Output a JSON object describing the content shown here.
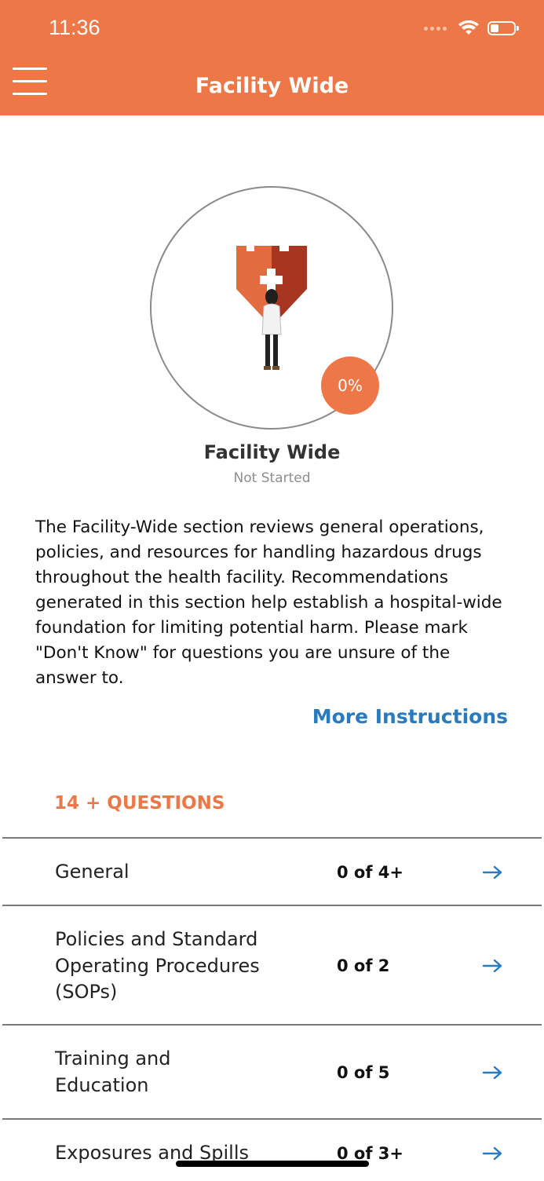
{
  "status_bar": {
    "time": "11:36"
  },
  "header": {
    "title": "Facility Wide"
  },
  "section": {
    "progress": "0%",
    "title": "Facility Wide",
    "status": "Not Started",
    "description": "The Facility-Wide section reviews general operations, policies, and resources for handling hazardous drugs throughout the health facility. Recommendations generated in this section help establish a hospital-wide foundation for limiting potential harm.  Please mark \"Don't Know\" for questions you are unsure of the answer to.",
    "more_instructions": "More Instructions"
  },
  "questions": {
    "count_label": "14 + QUESTIONS",
    "items": [
      {
        "label": "General",
        "progress": "0 of 4+"
      },
      {
        "label": "Policies and Standard Operating Procedures (SOPs)",
        "progress": "0 of 2"
      },
      {
        "label": "Training and Education",
        "progress": "0 of 5"
      },
      {
        "label": "Exposures and Spills",
        "progress": "0 of 3+"
      }
    ]
  },
  "colors": {
    "accent": "#ee7747",
    "link": "#2a7bbd"
  },
  "icons": [
    "menu-icon",
    "wifi-icon",
    "battery-icon",
    "arrow-right-icon"
  ]
}
